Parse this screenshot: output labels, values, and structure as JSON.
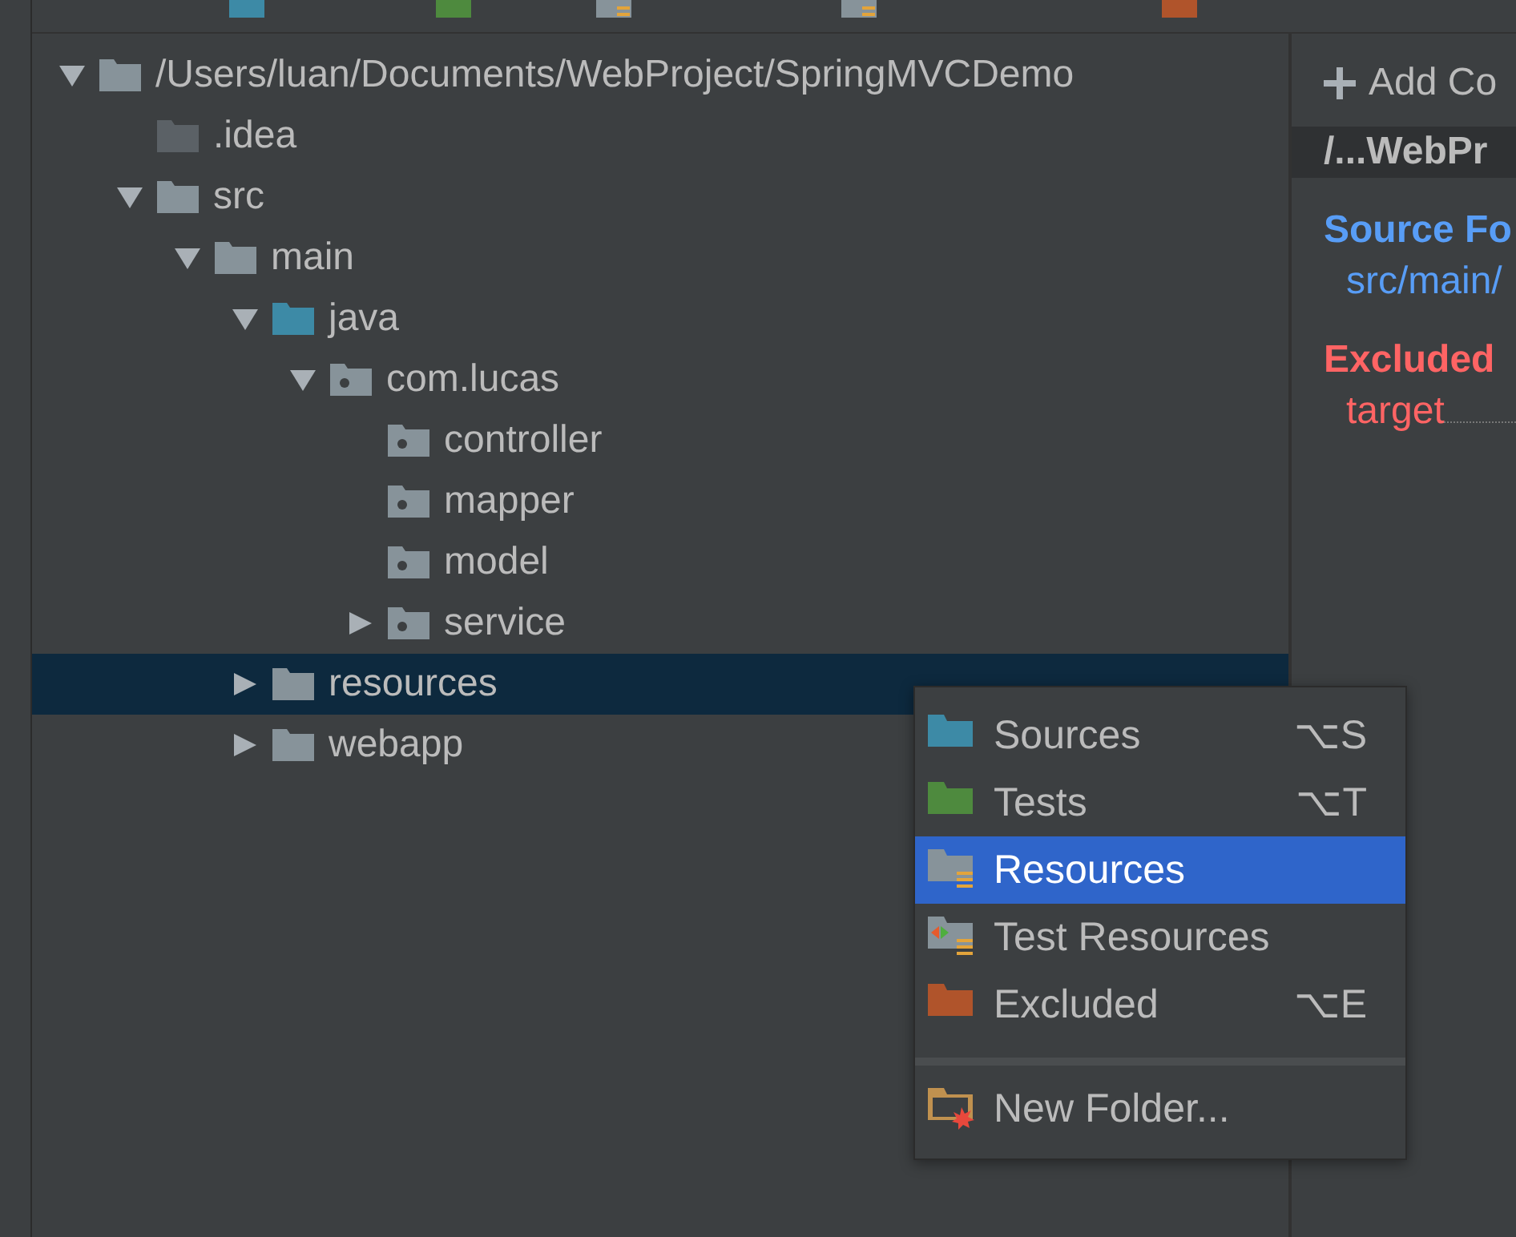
{
  "toolbar": {
    "items": [
      {
        "kind": "sources"
      },
      {
        "kind": "tests"
      },
      {
        "kind": "resources"
      },
      {
        "kind": "test_resources"
      },
      {
        "kind": "excluded"
      }
    ]
  },
  "tree": [
    {
      "label": "/Users/luan/Documents/WebProject/SpringMVCDemo",
      "kind": "folder",
      "expanded": true,
      "selected": false,
      "children": [
        {
          "label": ".idea",
          "kind": "dim",
          "selected": false
        },
        {
          "label": "src",
          "kind": "folder",
          "expanded": true,
          "selected": false,
          "children": [
            {
              "label": "main",
              "kind": "folder",
              "expanded": true,
              "selected": false,
              "children": [
                {
                  "label": "java",
                  "kind": "source",
                  "expanded": true,
                  "selected": false,
                  "children": [
                    {
                      "label": "com.lucas",
                      "kind": "package",
                      "expanded": true,
                      "selected": false,
                      "children": [
                        {
                          "label": "controller",
                          "kind": "package",
                          "selected": false
                        },
                        {
                          "label": "mapper",
                          "kind": "package",
                          "selected": false
                        },
                        {
                          "label": "model",
                          "kind": "package",
                          "selected": false
                        },
                        {
                          "label": "service",
                          "kind": "package",
                          "expanded": false,
                          "selected": false
                        }
                      ]
                    }
                  ]
                },
                {
                  "label": "resources",
                  "kind": "folder",
                  "expanded": false,
                  "selected": true
                },
                {
                  "label": "webapp",
                  "kind": "folder",
                  "expanded": false,
                  "selected": false
                }
              ]
            }
          ]
        }
      ]
    }
  ],
  "side_panel": {
    "add_button": "Add Co",
    "header": "/...WebPr",
    "sections": [
      {
        "title": "Source Fo",
        "kind": "source",
        "entries": [
          "src/main/"
        ]
      },
      {
        "title": "Excluded",
        "kind": "excluded",
        "entries": [
          "target"
        ]
      }
    ]
  },
  "context_menu": {
    "groups": [
      [
        {
          "label": "Sources",
          "kind": "sources",
          "shortcut": "⌥S",
          "selected": false
        },
        {
          "label": "Tests",
          "kind": "tests",
          "shortcut": "⌥T",
          "selected": false
        },
        {
          "label": "Resources",
          "kind": "resources",
          "selected": true
        },
        {
          "label": "Test Resources",
          "kind": "test_resources",
          "selected": false
        },
        {
          "label": "Excluded",
          "kind": "excluded",
          "shortcut": "⌥E",
          "selected": false
        }
      ],
      [
        {
          "label": "New Folder...",
          "kind": "new_folder",
          "selected": false
        }
      ]
    ]
  }
}
